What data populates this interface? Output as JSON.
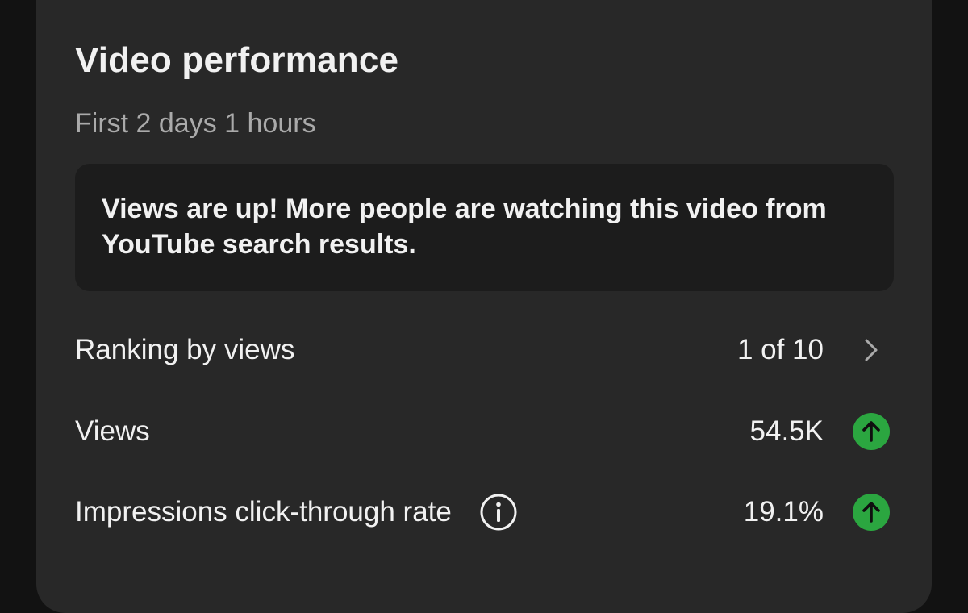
{
  "card": {
    "title": "Video performance",
    "subtitle": "First 2 days 1 hours",
    "insight": "Views are up! More people are watching this video from YouTube search results."
  },
  "rows": [
    {
      "label": "Ranking by views",
      "value": "1 of 10",
      "end_icon": "chevron-right-icon"
    },
    {
      "label": "Views",
      "value": "54.5K",
      "end_icon": "trend-up-icon"
    },
    {
      "label": "Impressions click-through rate",
      "value": "19.1%",
      "end_icon": "trend-up-icon",
      "has_info": true
    }
  ],
  "colors": {
    "background": "#121212",
    "card": "#282828",
    "insight_box": "#1c1c1c",
    "text_primary": "#f1f1f1",
    "text_secondary": "#aaaaaa",
    "trend_up": "#2ba640"
  }
}
